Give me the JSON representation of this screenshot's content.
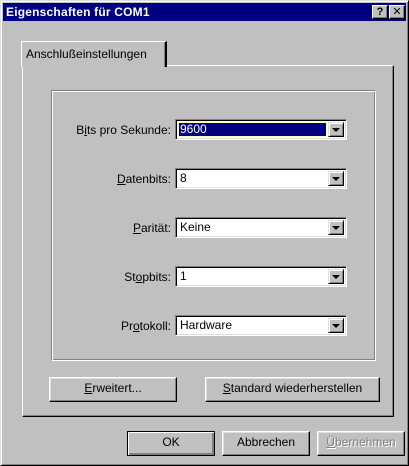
{
  "window": {
    "title": "Eigenschaften für COM1",
    "help_label": "?",
    "close_label": "✕"
  },
  "tabs": [
    {
      "label": "Anschlußeinstellungen",
      "active": true
    }
  ],
  "form": {
    "fields": [
      {
        "label_pre": "B",
        "label_acc": "i",
        "label_post": "ts pro Sekunde:",
        "value": "9600",
        "selected": true
      },
      {
        "label_pre": "",
        "label_acc": "D",
        "label_post": "atenbits:",
        "value": "8",
        "selected": false
      },
      {
        "label_pre": "",
        "label_acc": "P",
        "label_post": "arität:",
        "value": "Keine",
        "selected": false
      },
      {
        "label_pre": "St",
        "label_acc": "o",
        "label_post": "pbits:",
        "value": "1",
        "selected": false
      },
      {
        "label_pre": "Pr",
        "label_acc": "o",
        "label_post": "tokoll:",
        "value": "Hardware",
        "selected": false
      }
    ]
  },
  "panel_buttons": {
    "advanced": {
      "acc": "E",
      "rest": "rweitert..."
    },
    "restore": {
      "acc": "S",
      "rest": "tandard wiederherstellen"
    }
  },
  "footer_buttons": {
    "ok": "OK",
    "cancel": "Abbrechen",
    "apply": {
      "acc": "Ü",
      "rest": "bernehmen",
      "disabled": true
    }
  }
}
